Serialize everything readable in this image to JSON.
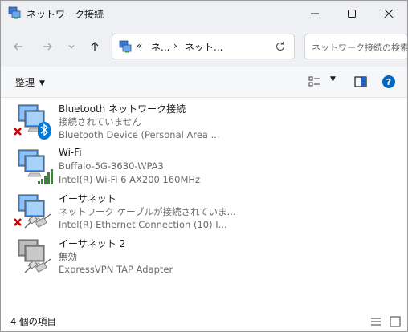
{
  "window": {
    "title": "ネットワーク接続",
    "icon": "network-connections-icon",
    "controls": [
      "minimize-icon",
      "maximize-icon",
      "close-icon"
    ]
  },
  "nav": {
    "back": "arrow-left-icon",
    "forward": "arrow-right-icon",
    "recent": "chevron-down-icon",
    "up": "arrow-up-icon"
  },
  "address": {
    "overflow": "«",
    "crumbs": [
      "ネ...",
      "ネット..."
    ],
    "separator": "›",
    "refresh": "refresh-icon"
  },
  "search": {
    "placeholder": "ネットワーク接続の検索"
  },
  "toolbar": {
    "organize": "整理",
    "view_icon": "view-options-icon",
    "preview_icon": "preview-pane-icon",
    "help_icon": "help-icon"
  },
  "items": [
    {
      "name": "Bluetooth ネットワーク接続",
      "status": "接続されていません",
      "device": "Bluetooth Device (Personal Area ...",
      "badge": "bluetooth",
      "error": true
    },
    {
      "name": "Wi-Fi",
      "status": "Buffalo-5G-3630-WPA3",
      "device": "Intel(R) Wi-Fi 6 AX200 160MHz",
      "badge": "signal",
      "error": false
    },
    {
      "name": "イーサネット",
      "status": "ネットワーク ケーブルが接続されていま...",
      "device": "Intel(R) Ethernet Connection (10) I...",
      "badge": "cable",
      "error": true
    },
    {
      "name": "イーサネット 2",
      "status": "無効",
      "device": "ExpressVPN TAP Adapter",
      "badge": "cable",
      "error": false,
      "disabled": true
    }
  ],
  "statusbar": {
    "count": "4 個の項目",
    "details_icon": "details-view-icon",
    "tiles_icon": "large-icons-view-icon"
  },
  "colors": {
    "accent": "#0067c0",
    "error": "#d50000",
    "bluetooth": "#0078d4",
    "signal": "#2e8b2e"
  }
}
